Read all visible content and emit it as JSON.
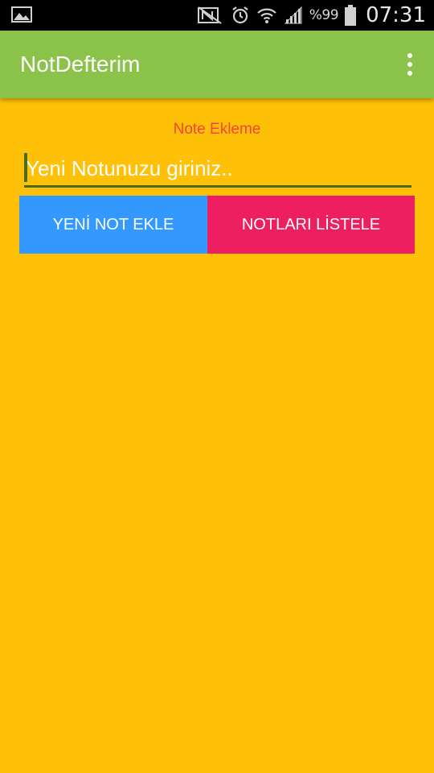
{
  "status_bar": {
    "battery_percent": "%99",
    "time": "07:31",
    "icons": [
      "image-notification-icon",
      "nfc-mute-icon",
      "alarm-icon",
      "wifi-icon",
      "signal-icon",
      "battery-icon"
    ]
  },
  "app_bar": {
    "title": "NotDefterim",
    "menu_icon": "overflow-menu-icon"
  },
  "content": {
    "section_label": "Note Ekleme",
    "note_input": {
      "placeholder": "Yeni Notunuzu giriniz..",
      "value": ""
    },
    "add_button_label": "YENİ NOT EKLE",
    "list_button_label": "NOTLARI LİSTELE"
  },
  "colors": {
    "background": "#FFC107",
    "app_bar": "#8BC34A",
    "label": "#F44336",
    "add_button": "#3399FF",
    "list_button": "#EE1F60",
    "input_underline": "#4A6B1D"
  }
}
